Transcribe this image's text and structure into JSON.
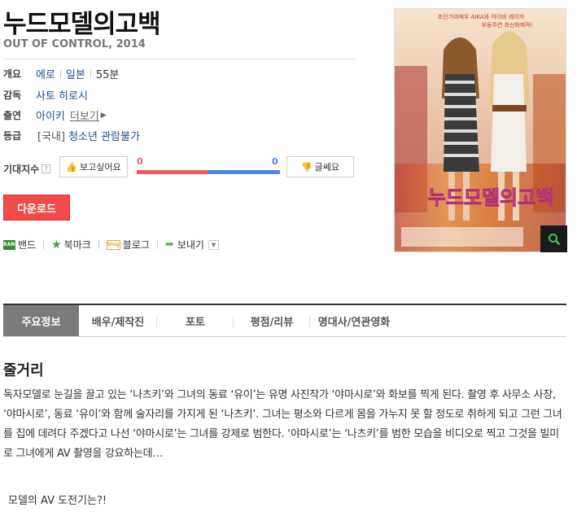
{
  "movie": {
    "title": "누드모델의고백",
    "subtitle": "OUT OF CONTROL, 2014"
  },
  "info": {
    "overview_label": "개요",
    "genre": "에로",
    "country": "일본",
    "runtime": "55분",
    "director_label": "감독",
    "director": "사토 히로시",
    "cast_label": "출연",
    "cast": "아이키",
    "more_label": "더보기",
    "grade_label": "등급",
    "grade_region": "[국내]",
    "grade": "청소년 관람불가"
  },
  "expect": {
    "label": "기대지수",
    "help": "?",
    "want_label": "보고싶어요",
    "want_count": "0",
    "unsure_label": "글쎄요",
    "unsure_count": "0",
    "want_ratio": 0.5,
    "colors": {
      "want": "#f05a5a",
      "unsure": "#4d88e0"
    }
  },
  "download_label": "다운로드",
  "share": {
    "band": "밴드",
    "band_icon_text": "BAND",
    "bookmark": "북마크",
    "blog": "블로그",
    "blog_icon_text": "blog",
    "send": "보내기"
  },
  "poster": {
    "tagline_1": "초인기여배우 AIKA와 아이바 레이카",
    "tagline_2": "부듬주연 최신화제작!",
    "title_overlay": "누드모델의고백",
    "icons": {
      "zoom": "magnifier-icon"
    }
  },
  "tabs": [
    "주요정보",
    "배우/제작진",
    "포토",
    "평점/리뷰",
    "명대사/연관영화"
  ],
  "synopsis": {
    "heading": "줄거리",
    "body": "독자모델로 눈길을 끌고 있는 ‘나츠키’와 그녀의 동료 ‘유이’는 유명 사진작가 ‘야마시로’와 화보를 찍게 된다. 촬영 후 사무소 사장, ‘야마시로’, 동료 ‘유이’와 함께 술자리를 가지게 된 ‘나츠키’. 그녀는 평소와 다르게 몸을 가누지 못 할 정도로 취하게 되고 그런 그녀를 집에 데려다 주겠다고 나선 ‘야마시로’는 그녀를 강제로 범한다. ‘야마시로’는 ‘나츠키’를 범한 모습을 비디오로 찍고 그것을 빌미로 그녀에게 AV 촬영을 강요하는데…",
    "closing": "모델의 AV 도전기는?!"
  }
}
